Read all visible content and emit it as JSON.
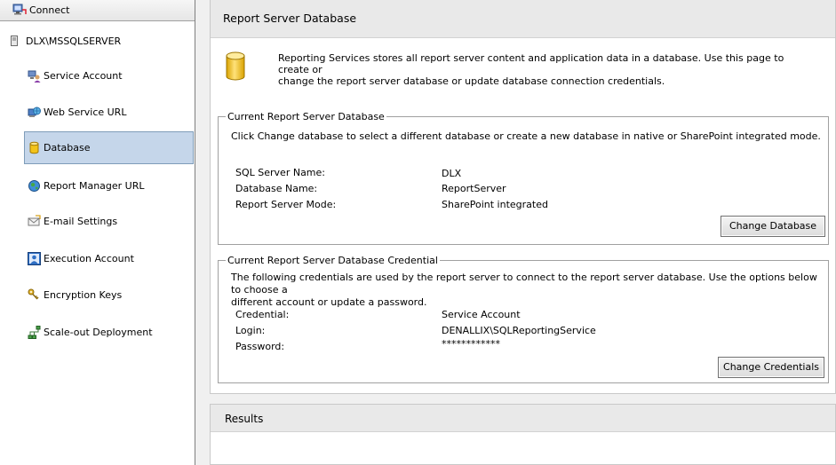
{
  "sidebar": {
    "connect_label": "Connect",
    "server_name": "DLX\\MSSQLSERVER",
    "items": [
      {
        "label": "Service Account",
        "icon": "service-account-icon"
      },
      {
        "label": "Web Service URL",
        "icon": "web-service-icon"
      },
      {
        "label": "Database",
        "icon": "database-icon",
        "selected": true
      },
      {
        "label": "Report Manager URL",
        "icon": "globe-icon"
      },
      {
        "label": "E-mail Settings",
        "icon": "email-icon"
      },
      {
        "label": "Execution Account",
        "icon": "execution-account-icon"
      },
      {
        "label": "Encryption Keys",
        "icon": "keys-icon"
      },
      {
        "label": "Scale-out Deployment",
        "icon": "scale-out-icon"
      }
    ]
  },
  "page": {
    "title": "Report Server Database",
    "intro_line1": "Reporting Services stores all report server content and application data in a database. Use this page to create or",
    "intro_line2": "change the report server database or update database connection credentials."
  },
  "current_db": {
    "legend": "Current Report Server Database",
    "description": "Click Change database to select a different database or create a new database in native or SharePoint integrated mode.",
    "sql_server_label": "SQL Server Name:",
    "sql_server_value": "DLX",
    "db_name_label": "Database Name:",
    "db_name_value": "ReportServer",
    "mode_label": "Report Server Mode:",
    "mode_value": "SharePoint integrated",
    "button": "Change Database"
  },
  "credential": {
    "legend": "Current Report Server Database Credential",
    "description_line1": "The following credentials are used by the report server to connect to the report server database.  Use the options below to choose a",
    "description_line2": "different account or update a password.",
    "credential_label": "Credential:",
    "credential_value": "Service Account",
    "login_label": "Login:",
    "login_value": "DENALLIX\\SQLReportingService",
    "password_label": "Password:",
    "password_value": "************",
    "button": "Change Credentials"
  },
  "results": {
    "title": "Results"
  },
  "colors": {
    "selected_bg": "#c5d6ea",
    "header_bg": "#e9e9e9",
    "database_yellow": "#f2c31a"
  }
}
